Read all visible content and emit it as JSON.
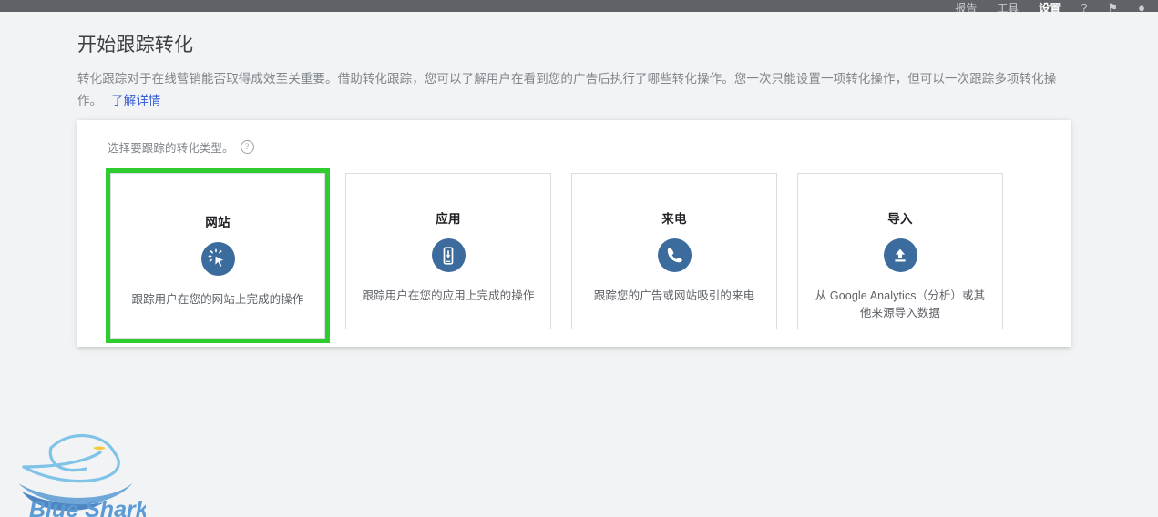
{
  "topbar": {
    "nav_items": [
      {
        "label": "报告",
        "active": false
      },
      {
        "label": "工具",
        "active": false
      },
      {
        "label": "设置",
        "active": true
      }
    ],
    "icons": [
      {
        "name": "help-icon",
        "glyph": "?"
      },
      {
        "name": "notifications-icon",
        "glyph": "⚑"
      },
      {
        "name": "account-icon",
        "glyph": "●"
      }
    ],
    "background_color": "#5f6368"
  },
  "page": {
    "title": "开始跟踪转化",
    "description": "转化跟踪对于在线营销能否取得成效至关重要。借助转化跟踪，您可以了解用户在看到您的广告后执行了哪些转化操作。您一次只能设置一项转化操作，但可以一次跟踪多项转化操作。",
    "learn_more_label": "了解详情",
    "background_color": "#f1f3f4"
  },
  "panel": {
    "section_label": "选择要跟踪的转化类型。",
    "help_icon_glyph": "?",
    "selection_highlight_color": "#2fcc2f",
    "icon_circle_color": "#3c6b9e",
    "cards": [
      {
        "title": "网站",
        "description": "跟踪用户在您的网站上完成的操作",
        "icon": "click-cursor-icon",
        "selected": true
      },
      {
        "title": "应用",
        "description": "跟踪用户在您的应用上完成的操作",
        "icon": "mobile-app-download-icon",
        "selected": false
      },
      {
        "title": "来电",
        "description": "跟踪您的广告或网站吸引的来电",
        "icon": "phone-call-icon",
        "selected": false
      },
      {
        "title": "导入",
        "description": "从 Google Analytics（分析）或其他来源导入数据",
        "icon": "upload-import-icon",
        "selected": false
      }
    ]
  },
  "brand": {
    "name": "Blue Shark",
    "primary_color": "#4da6d9",
    "secondary_color": "#5b8fc9"
  }
}
